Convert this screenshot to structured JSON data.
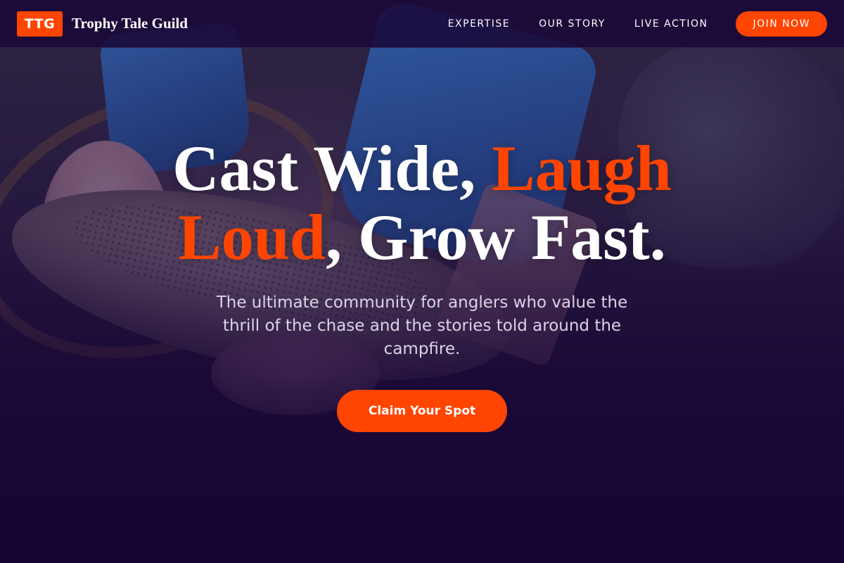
{
  "header": {
    "logo_text": "TTG",
    "brand_name": "Trophy Tale Guild",
    "nav": [
      {
        "label": "EXPERTISE"
      },
      {
        "label": "OUR STORY"
      },
      {
        "label": "LIVE ACTION"
      }
    ],
    "join_label": "JOIN NOW"
  },
  "hero": {
    "heading_part1": "Cast Wide, ",
    "heading_accent1": "Laugh Loud",
    "heading_part2": ", Grow Fast.",
    "subtext": "The ultimate community for anglers who value the thrill of the chase and the stories told around the campfire.",
    "cta_label": "Claim Your Spot",
    "background_image": "angler-holding-rainbow-trout"
  },
  "theme": {
    "accent": "#ff4500",
    "nav_background": "#1a0838",
    "page_background": "#17072f",
    "subtext_color": "#dcd3e6"
  }
}
